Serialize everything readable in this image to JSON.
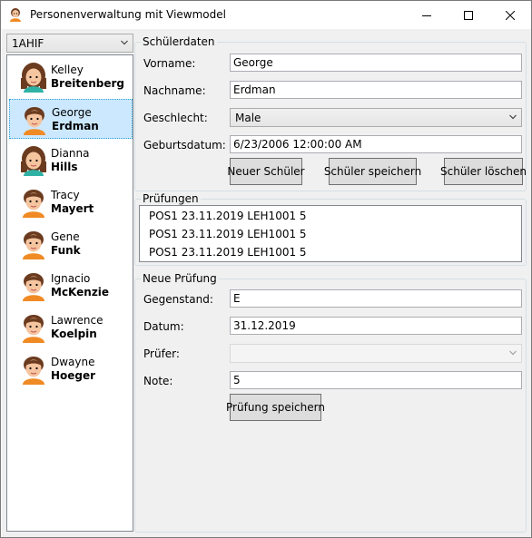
{
  "window": {
    "title": "Personenverwaltung mit Viewmodel"
  },
  "class_selector": {
    "value": "1AHIF"
  },
  "people": [
    {
      "first": "Kelley",
      "last": "Breitenberg",
      "avatar": "female-avatar-icon"
    },
    {
      "first": "George",
      "last": "Erdman",
      "avatar": "male-avatar-icon"
    },
    {
      "first": "Dianna",
      "last": "Hills",
      "avatar": "female-avatar-icon"
    },
    {
      "first": "Tracy",
      "last": "Mayert",
      "avatar": "male-avatar-icon"
    },
    {
      "first": "Gene",
      "last": "Funk",
      "avatar": "male-avatar-icon"
    },
    {
      "first": "Ignacio",
      "last": "McKenzie",
      "avatar": "male-avatar-icon"
    },
    {
      "first": "Lawrence",
      "last": "Koelpin",
      "avatar": "male-avatar-icon"
    },
    {
      "first": "Dwayne",
      "last": "Hoeger",
      "avatar": "male-avatar-icon"
    }
  ],
  "selected_person_index": 1,
  "student": {
    "group_title": "Schülerdaten",
    "firstname_label": "Vorname:",
    "firstname_value": "George",
    "lastname_label": "Nachname:",
    "lastname_value": "Erdman",
    "gender_label": "Geschlecht:",
    "gender_value": "Male",
    "birthdate_label": "Geburtsdatum:",
    "birthdate_value": "6/23/2006 12:00:00 AM",
    "new_button": "Neuer Schüler",
    "save_button": "Schüler speichern",
    "delete_button": "Schüler löschen"
  },
  "exams": {
    "group_title": "Prüfungen",
    "items": [
      "POS1 23.11.2019 LEH1001 5",
      "POS1 23.11.2019 LEH1001 5",
      "POS1 23.11.2019 LEH1001 5"
    ]
  },
  "new_exam": {
    "group_title": "Neue Prüfung",
    "subject_label": "Gegenstand:",
    "subject_value": "E",
    "date_label": "Datum:",
    "date_value": "31.12.2019",
    "examiner_label": "Prüfer:",
    "examiner_value": "",
    "grade_label": "Note:",
    "grade_value": "5",
    "save_button": "Prüfung speichern"
  },
  "colors": {
    "selection_bg": "#cce8ff",
    "selection_border": "#26a0da",
    "client_bg": "#f0f0f0"
  }
}
